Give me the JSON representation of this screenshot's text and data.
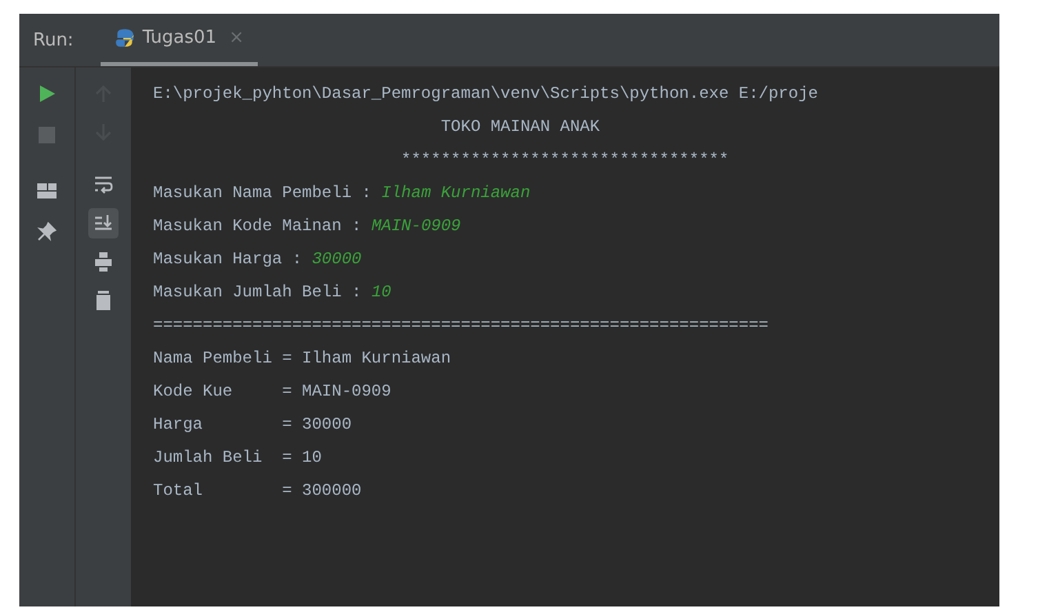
{
  "panel": {
    "label": "Run:",
    "tabs": [
      {
        "label": "Tugas01",
        "selected": true,
        "close": "×"
      }
    ]
  },
  "toolbar": {
    "scroll_to_end_on": true
  },
  "console": [
    {
      "kind": "text",
      "text": "E:\\projek_pyhton\\Dasar_Pemrograman\\venv\\Scripts\\python.exe E:/proje"
    },
    {
      "kind": "text",
      "text": "                             TOKO MAINAN ANAK"
    },
    {
      "kind": "text",
      "text": "                         *********************************"
    },
    {
      "kind": "prompt",
      "text": "Masukan Nama Pembeli : ",
      "input": "Ilham Kurniawan"
    },
    {
      "kind": "prompt",
      "text": "Masukan Kode Mainan : ",
      "input": "MAIN-0909"
    },
    {
      "kind": "prompt",
      "text": "Masukan Harga : ",
      "input": "30000"
    },
    {
      "kind": "prompt",
      "text": "Masukan Jumlah Beli : ",
      "input": "10"
    },
    {
      "kind": "text",
      "text": "=============================================================="
    },
    {
      "kind": "text",
      "text": "Nama Pembeli = Ilham Kurniawan"
    },
    {
      "kind": "text",
      "text": "Kode Kue     = MAIN-0909"
    },
    {
      "kind": "text",
      "text": "Harga        = 30000"
    },
    {
      "kind": "text",
      "text": "Jumlah Beli  = 10"
    },
    {
      "kind": "text",
      "text": "Total        = 300000"
    }
  ]
}
